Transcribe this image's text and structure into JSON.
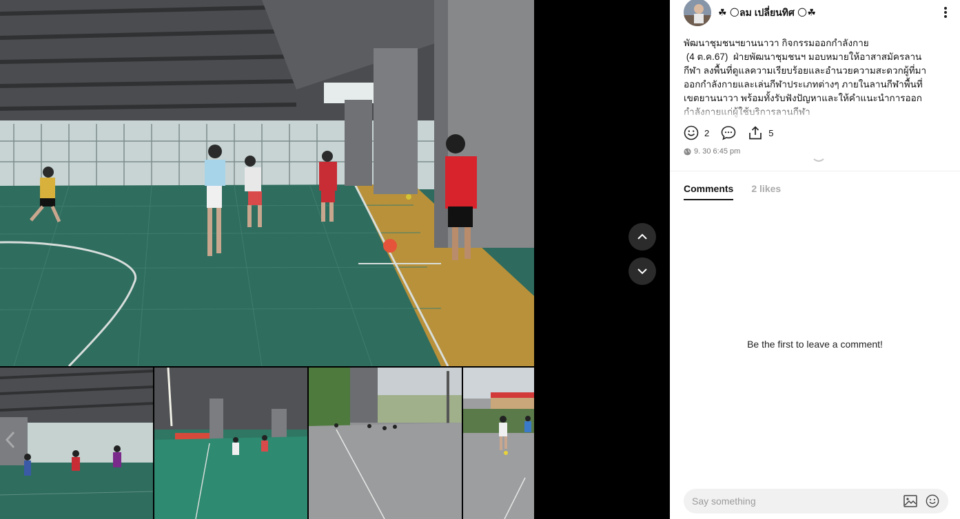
{
  "post": {
    "author": "☘ 🌕ลม เปลี่ยนทิศ 🌕☘",
    "text": "พัฒนาชุมชนฯยานนาวา กิจกรรมออกกำลังกาย\n (4 ต.ค.67)  ฝ่ายพัฒนาชุมชนฯ มอบหมายให้อาสาสมัครลาน\nกีฬา ลงพื้นที่ดูแลความเรียบร้อยและอำนวยความสะดวกผู้ที่มา\nออกกำลังกายและเล่นกีฬาประเภทต่างๆ ภายในลานกีฬาพื้นที่\nเขตยานนาวา พร้อมทั้งรับฟังปัญหาและให้คำแนะนำการออก\nกำลังกายแก่ผู้ใช้บริการลานกีฬา",
    "reactions_count": "2",
    "shares_count": "5",
    "timestamp": "9. 30 6:45 pm"
  },
  "tabs": {
    "comments": "Comments",
    "likes": "2 likes"
  },
  "comments": {
    "empty_message": "Be the first to leave a comment!",
    "input_placeholder": "Say something"
  },
  "media": {
    "thumbnail_count": 4,
    "icons": [
      "chevron-up-icon",
      "chevron-down-icon",
      "chevron-right-icon",
      "chevron-left-icon"
    ]
  },
  "colors": {
    "viewer_background": "#000000",
    "panel_background": "#ffffff",
    "court_green": "#2e6b5d",
    "court_yellow": "#b78a2a"
  }
}
